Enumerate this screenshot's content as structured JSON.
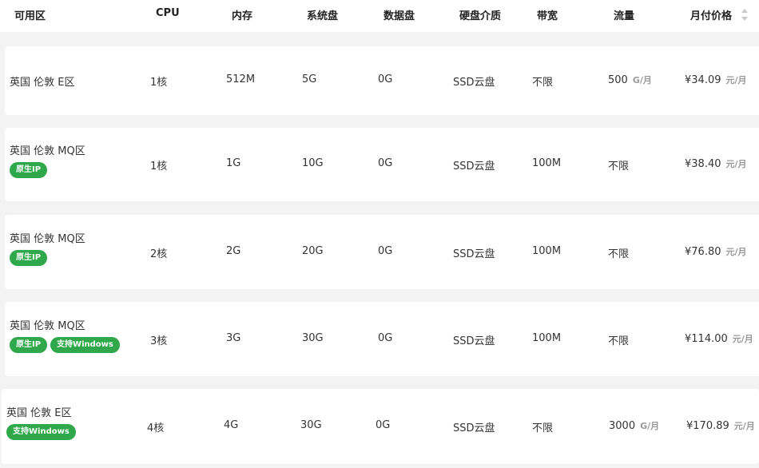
{
  "header": {
    "cols": [
      "可用区",
      "CPU",
      "内存",
      "系统盘",
      "数据盘",
      "硬盘介质",
      "带宽",
      "流量",
      "月付价格"
    ]
  },
  "rows": [
    {
      "region": "英国 伦敦 E区",
      "badges": [],
      "cpu": "1核",
      "mem": "512M",
      "sysdisk": "5G",
      "datadisk": "0G",
      "media": "SSD云盘",
      "bandwidth": "不限",
      "traffic": "500",
      "traffic_unit": "G/月",
      "price": "¥34.09",
      "price_unit": "元/月"
    },
    {
      "region": "英国 伦敦 MQ区",
      "badges": [
        "原生IP"
      ],
      "cpu": "1核",
      "mem": "1G",
      "sysdisk": "10G",
      "datadisk": "0G",
      "media": "SSD云盘",
      "bandwidth": "100M",
      "traffic": "不限",
      "traffic_unit": "",
      "price": "¥38.40",
      "price_unit": "元/月"
    },
    {
      "region": "英国 伦敦 MQ区",
      "badges": [
        "原生IP"
      ],
      "cpu": "2核",
      "mem": "2G",
      "sysdisk": "20G",
      "datadisk": "0G",
      "media": "SSD云盘",
      "bandwidth": "100M",
      "traffic": "不限",
      "traffic_unit": "",
      "price": "¥76.80",
      "price_unit": "元/月"
    },
    {
      "region": "英国 伦敦 MQ区",
      "badges": [
        "原生IP",
        "支持Windows"
      ],
      "cpu": "3核",
      "mem": "3G",
      "sysdisk": "30G",
      "datadisk": "0G",
      "media": "SSD云盘",
      "bandwidth": "100M",
      "traffic": "不限",
      "traffic_unit": "",
      "price": "¥114.00",
      "price_unit": "元/月"
    },
    {
      "region": "英国 伦敦 E区",
      "badges": [
        "支持Windows"
      ],
      "cpu": "4核",
      "mem": "4G",
      "sysdisk": "30G",
      "datadisk": "0G",
      "media": "SSD云盘",
      "bandwidth": "不限",
      "traffic": "3000",
      "traffic_unit": "G/月",
      "price": "¥170.89",
      "price_unit": "元/月"
    }
  ],
  "colors": {
    "badge": "#2ea84a",
    "background": "#f3f3f3",
    "row": "#ffffff"
  }
}
